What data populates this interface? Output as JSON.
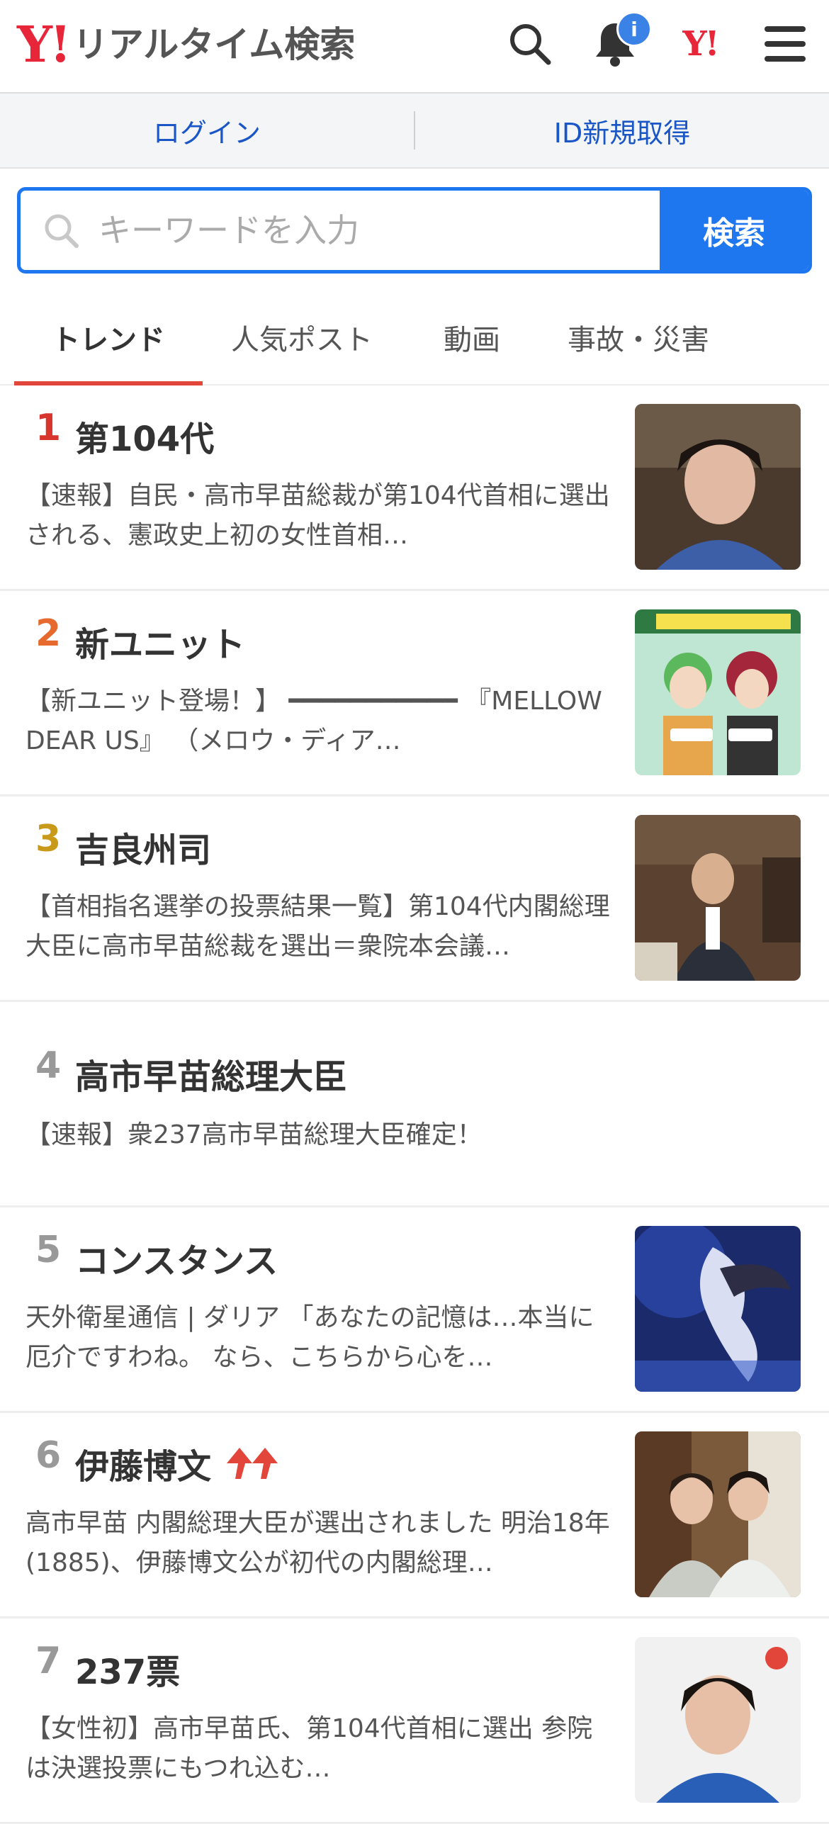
{
  "header": {
    "logo_mark": "Y!",
    "logo_text": "リアルタイム検索",
    "notification_badge": "i",
    "yahoo_mark": "Y!"
  },
  "account": {
    "login_label": "ログイン",
    "signup_label": "ID新規取得"
  },
  "search": {
    "placeholder": "キーワードを入力",
    "button_label": "検索"
  },
  "tabs": [
    {
      "label": "トレンド",
      "active": true
    },
    {
      "label": "人気ポスト",
      "active": false
    },
    {
      "label": "動画",
      "active": false
    },
    {
      "label": "事故・災害",
      "active": false
    }
  ],
  "trends": [
    {
      "rank": "1",
      "title": "第104代",
      "desc": "【速報】自民・高市早苗総裁が第104代首相に選出される、憲政史上初の女性首相…",
      "image": "politician-portrait"
    },
    {
      "rank": "2",
      "title": "新ユニット",
      "desc": "【新ユニット登場！】 ━━━━━━━━━━━ 『MELLOW DEAR US』 （メロウ・ディア…",
      "image": "anime-unit-art"
    },
    {
      "rank": "3",
      "title": "吉良州司",
      "desc": "【首相指名選挙の投票結果一覧】第104代内閣総理大臣に高市早苗総裁を選出＝衆院本会議…",
      "image": "stream-screenshot"
    },
    {
      "rank": "4",
      "title": "高市早苗総理大臣",
      "desc": "【速報】衆237高市早苗総理大臣確定！",
      "image": ""
    },
    {
      "rank": "5",
      "title": "コンスタンス",
      "desc": "天外衛星通信 | ダリア 「あなたの記憶は…本当に厄介ですわね。 なら、こちらから心を…",
      "image": "game-character-art"
    },
    {
      "rank": "6",
      "title": "伊藤博文",
      "desc": "高市早苗 内閣総理大臣が選出されました 明治18年(1885)、伊藤博文公が初代の内閣総理…",
      "image": "two-women-photo",
      "trend_icon": "rising-arrows-icon"
    },
    {
      "rank": "7",
      "title": "237票",
      "desc": "【女性初】高市早苗氏、第104代首相に選出 参院は決選投票にもつれ込む…",
      "image": "politician-photo"
    }
  ],
  "colors": {
    "brand_red": "#e8263a",
    "accent_blue": "#1f77f0",
    "rank1": "#d8352f",
    "rank2": "#e66a2d",
    "rank3": "#c99a1a",
    "rank_other": "#999999"
  }
}
